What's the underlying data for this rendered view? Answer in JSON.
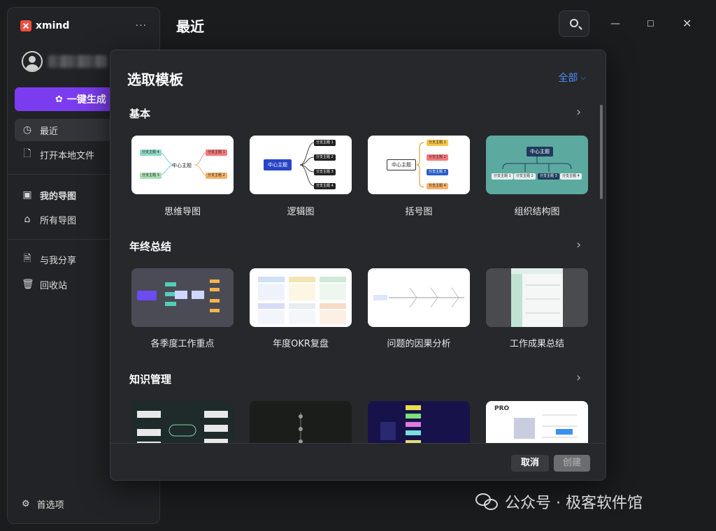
{
  "app": {
    "name": "xmind",
    "more_label": "···"
  },
  "sidebar": {
    "generate_label": "一键生成",
    "items": [
      {
        "label": "最近",
        "icon": "clock-icon",
        "active": true
      },
      {
        "label": "打开本地文件",
        "icon": "open-file-icon"
      },
      {
        "label": "我的导图",
        "icon": "drive-icon"
      },
      {
        "label": "所有导图",
        "icon": "home-icon"
      },
      {
        "label": "与我分享",
        "icon": "shared-file-icon"
      },
      {
        "label": "回收站",
        "icon": "trash-icon"
      }
    ],
    "preferences_label": "首选项"
  },
  "header": {
    "title": "最近"
  },
  "modal": {
    "title": "选取模板",
    "filter_label": "全部",
    "sections": [
      {
        "title": "基本",
        "cards": [
          {
            "label": "思维导图",
            "preview": {
              "center": "中心主题",
              "topics": [
                "分支主题 4",
                "分支主题 1",
                "分支主题 3",
                "分支主题 2"
              ]
            }
          },
          {
            "label": "逻辑图",
            "preview": {
              "center": "中心主题",
              "topics": [
                "分支主题 1",
                "分支主题 2",
                "分支主题 3",
                "分支主题 4"
              ]
            }
          },
          {
            "label": "括号图",
            "preview": {
              "center": "中心主题",
              "topics": [
                "分支主题 1",
                "分支主题 2",
                "分支主题 3",
                "分支主题 4"
              ]
            }
          },
          {
            "label": "组织结构图",
            "preview": {
              "center": "中心主题",
              "topics": [
                "分支主题 1",
                "分支主题 2",
                "分支主题 3",
                "分支主题 4"
              ]
            }
          }
        ]
      },
      {
        "title": "年终总结",
        "cards": [
          {
            "label": "各季度工作重点"
          },
          {
            "label": "年度OKR复盘"
          },
          {
            "label": "问题的因果分析"
          },
          {
            "label": "工作成果总结"
          }
        ]
      },
      {
        "title": "知识管理",
        "cards": [
          {
            "label": ""
          },
          {
            "label": ""
          },
          {
            "label": ""
          },
          {
            "label": "",
            "badge": "PRO"
          }
        ]
      }
    ],
    "cancel_label": "取消",
    "create_label": "创建"
  },
  "watermark": {
    "text": "公众号 · 极客软件馆"
  },
  "colors": {
    "accent": "#7b3cf0",
    "link": "#4b8ef7",
    "org_chart_bg": "#5ca9a0"
  }
}
